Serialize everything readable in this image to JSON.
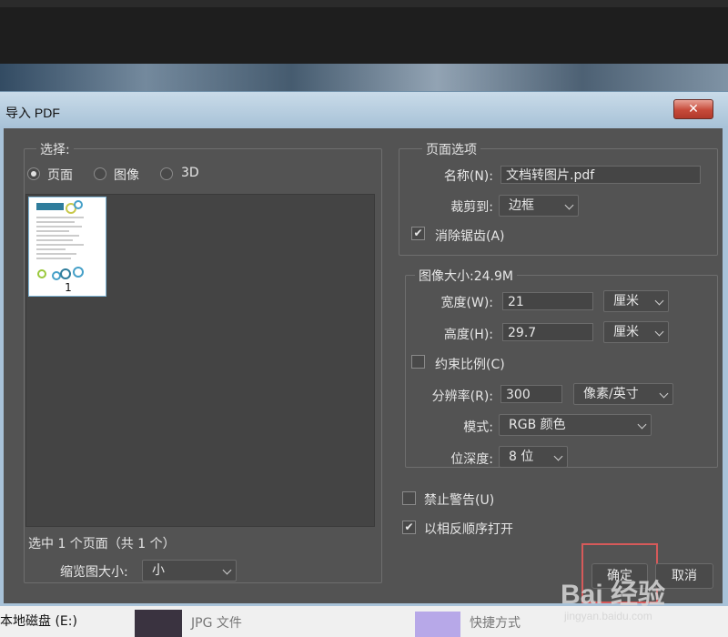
{
  "dialog": {
    "title": "导入 PDF",
    "close_glyph": "✕"
  },
  "select_panel": {
    "legend": "选择:",
    "options": [
      {
        "label": "页面",
        "checked": true
      },
      {
        "label": "图像",
        "checked": false
      },
      {
        "label": "3D",
        "checked": false
      }
    ],
    "thumbnail_number": "1",
    "selection_status": "选中 1 个页面（共 1 个）",
    "thumbnail_size_label": "缩览图大小:",
    "thumbnail_size_value": "小"
  },
  "page_options": {
    "legend": "页面选项",
    "name_label": "名称(N):",
    "name_value": "文档转图片.pdf",
    "crop_label": "裁剪到:",
    "crop_value": "边框",
    "antialias_label": "消除锯齿(A)",
    "antialias_checked": true
  },
  "image_size": {
    "legend": "图像大小:24.9M",
    "width_label": "宽度(W):",
    "width_value": "21",
    "width_unit": "厘米",
    "height_label": "高度(H):",
    "height_value": "29.7",
    "height_unit": "厘米",
    "constrain_label": "约束比例(C)",
    "constrain_checked": false,
    "resolution_label": "分辨率(R):",
    "resolution_value": "300",
    "resolution_unit": "像素/英寸",
    "mode_label": "模式:",
    "mode_value": "RGB 颜色",
    "depth_label": "位深度:",
    "depth_value": "8 位"
  },
  "options": {
    "suppress_warnings_label": "禁止警告(U)",
    "suppress_warnings_checked": false,
    "reverse_order_label": "以相反顺序打开",
    "reverse_order_checked": true
  },
  "buttons": {
    "ok": "确定",
    "cancel": "取消"
  },
  "background": {
    "disk_label": "本地磁盘 (E:)",
    "file_type": "JPG 文件",
    "shortcut": "快捷方式"
  },
  "watermark": {
    "text": "Bai 经验",
    "url": "jingyan.baidu.com"
  }
}
